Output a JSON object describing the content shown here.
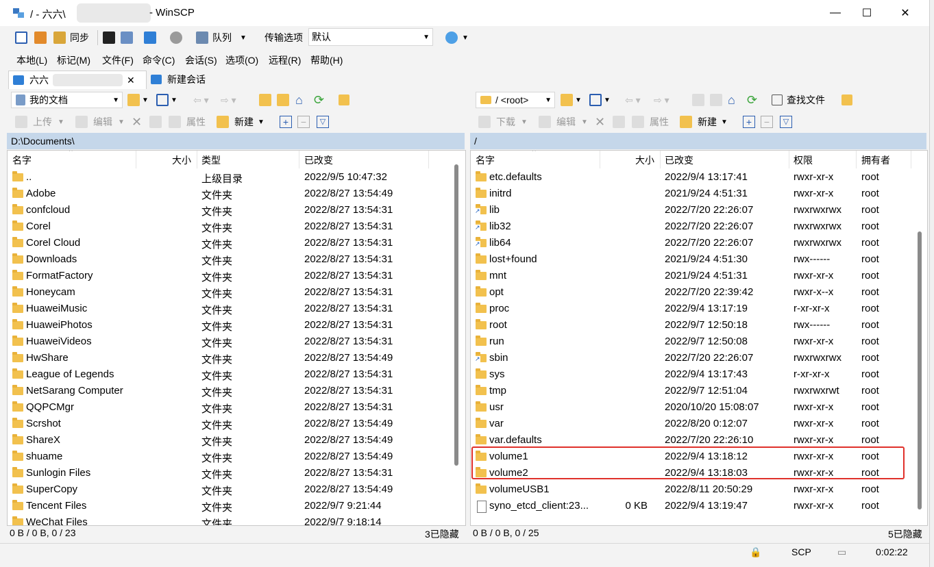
{
  "window": {
    "title_prefix": "/ - 六六\\",
    "title_suffix": "- WinSCP",
    "minimize": "—",
    "maximize": "☐",
    "close": "✕"
  },
  "toolbar": {
    "sync_label": "同步",
    "queue_label": "队列",
    "transfer_options_label": "传输选项",
    "transfer_options_value": "默认"
  },
  "menu": [
    "本地(L)",
    "标记(M)",
    "文件(F)",
    "命令(C)",
    "会话(S)",
    "选项(O)",
    "远程(R)",
    "帮助(H)"
  ],
  "tabs": {
    "session_tab": "六六",
    "close_glyph": "✕",
    "new_session": "新建会话"
  },
  "left": {
    "location": "我的文档",
    "upload": "上传",
    "edit": "编辑",
    "properties": "属性",
    "new": "新建",
    "path": "D:\\Documents\\",
    "headers": {
      "name": "名字",
      "size": "大小",
      "type": "类型",
      "changed": "已改变"
    },
    "rows": [
      {
        "name": "..",
        "type": "上级目录",
        "changed": "2022/9/5  10:47:32",
        "icon": "parent-folder-icon"
      },
      {
        "name": "Adobe",
        "type": "文件夹",
        "changed": "2022/8/27  13:54:49",
        "icon": "folder-icon"
      },
      {
        "name": "confcloud",
        "type": "文件夹",
        "changed": "2022/8/27  13:54:31",
        "icon": "folder-icon"
      },
      {
        "name": "Corel",
        "type": "文件夹",
        "changed": "2022/8/27  13:54:31",
        "icon": "folder-icon"
      },
      {
        "name": "Corel Cloud",
        "type": "文件夹",
        "changed": "2022/8/27  13:54:31",
        "icon": "folder-icon"
      },
      {
        "name": "Downloads",
        "type": "文件夹",
        "changed": "2022/8/27  13:54:31",
        "icon": "folder-icon"
      },
      {
        "name": "FormatFactory",
        "type": "文件夹",
        "changed": "2022/8/27  13:54:31",
        "icon": "folder-icon"
      },
      {
        "name": "Honeycam",
        "type": "文件夹",
        "changed": "2022/8/27  13:54:31",
        "icon": "folder-icon"
      },
      {
        "name": "HuaweiMusic",
        "type": "文件夹",
        "changed": "2022/8/27  13:54:31",
        "icon": "folder-icon"
      },
      {
        "name": "HuaweiPhotos",
        "type": "文件夹",
        "changed": "2022/8/27  13:54:31",
        "icon": "folder-icon"
      },
      {
        "name": "HuaweiVideos",
        "type": "文件夹",
        "changed": "2022/8/27  13:54:31",
        "icon": "folder-icon"
      },
      {
        "name": "HwShare",
        "type": "文件夹",
        "changed": "2022/8/27  13:54:49",
        "icon": "folder-icon"
      },
      {
        "name": "League of Legends",
        "type": "文件夹",
        "changed": "2022/8/27  13:54:31",
        "icon": "folder-icon"
      },
      {
        "name": "NetSarang Computer",
        "type": "文件夹",
        "changed": "2022/8/27  13:54:31",
        "icon": "folder-icon"
      },
      {
        "name": "QQPCMgr",
        "type": "文件夹",
        "changed": "2022/8/27  13:54:31",
        "icon": "folder-icon"
      },
      {
        "name": "Scrshot",
        "type": "文件夹",
        "changed": "2022/8/27  13:54:49",
        "icon": "folder-icon"
      },
      {
        "name": "ShareX",
        "type": "文件夹",
        "changed": "2022/8/27  13:54:49",
        "icon": "folder-icon"
      },
      {
        "name": "shuame",
        "type": "文件夹",
        "changed": "2022/8/27  13:54:49",
        "icon": "folder-icon"
      },
      {
        "name": "Sunlogin Files",
        "type": "文件夹",
        "changed": "2022/8/27  13:54:31",
        "icon": "folder-icon"
      },
      {
        "name": "SuperCopy",
        "type": "文件夹",
        "changed": "2022/8/27  13:54:49",
        "icon": "folder-icon"
      },
      {
        "name": "Tencent Files",
        "type": "文件夹",
        "changed": "2022/9/7  9:21:44",
        "icon": "folder-icon"
      },
      {
        "name": "WeChat Files",
        "type": "文件夹",
        "changed": "2022/9/7  9:18:14",
        "icon": "folder-icon"
      }
    ],
    "status_left": "0 B / 0 B,  0 / 23",
    "status_right": "3已隐藏"
  },
  "right": {
    "location": "/ <root>",
    "download": "下载",
    "edit": "编辑",
    "properties": "属性",
    "new": "新建",
    "find_files": "查找文件",
    "path": "/",
    "headers": {
      "name": "名字",
      "size": "大小",
      "changed": "已改变",
      "rights": "权限",
      "owner": "拥有者"
    },
    "rows": [
      {
        "name": "etc.defaults",
        "size": "",
        "changed": "2022/9/4 13:17:41",
        "rights": "rwxr-xr-x",
        "owner": "root",
        "icon": "folder-icon",
        "link": false
      },
      {
        "name": "initrd",
        "size": "",
        "changed": "2021/9/24 4:51:31",
        "rights": "rwxr-xr-x",
        "owner": "root",
        "icon": "folder-icon",
        "link": false
      },
      {
        "name": "lib",
        "size": "",
        "changed": "2022/7/20 22:26:07",
        "rights": "rwxrwxrwx",
        "owner": "root",
        "icon": "folder-link-icon",
        "link": true
      },
      {
        "name": "lib32",
        "size": "",
        "changed": "2022/7/20 22:26:07",
        "rights": "rwxrwxrwx",
        "owner": "root",
        "icon": "folder-link-icon",
        "link": true
      },
      {
        "name": "lib64",
        "size": "",
        "changed": "2022/7/20 22:26:07",
        "rights": "rwxrwxrwx",
        "owner": "root",
        "icon": "folder-link-icon",
        "link": true
      },
      {
        "name": "lost+found",
        "size": "",
        "changed": "2021/9/24 4:51:30",
        "rights": "rwx------",
        "owner": "root",
        "icon": "folder-icon",
        "link": false
      },
      {
        "name": "mnt",
        "size": "",
        "changed": "2021/9/24 4:51:31",
        "rights": "rwxr-xr-x",
        "owner": "root",
        "icon": "folder-icon",
        "link": false
      },
      {
        "name": "opt",
        "size": "",
        "changed": "2022/7/20 22:39:42",
        "rights": "rwxr-x--x",
        "owner": "root",
        "icon": "folder-icon",
        "link": false
      },
      {
        "name": "proc",
        "size": "",
        "changed": "2022/9/4 13:17:19",
        "rights": "r-xr-xr-x",
        "owner": "root",
        "icon": "folder-icon",
        "link": false
      },
      {
        "name": "root",
        "size": "",
        "changed": "2022/9/7 12:50:18",
        "rights": "rwx------",
        "owner": "root",
        "icon": "folder-icon",
        "link": false
      },
      {
        "name": "run",
        "size": "",
        "changed": "2022/9/7 12:50:08",
        "rights": "rwxr-xr-x",
        "owner": "root",
        "icon": "folder-icon",
        "link": false
      },
      {
        "name": "sbin",
        "size": "",
        "changed": "2022/7/20 22:26:07",
        "rights": "rwxrwxrwx",
        "owner": "root",
        "icon": "folder-link-icon",
        "link": true
      },
      {
        "name": "sys",
        "size": "",
        "changed": "2022/9/4 13:17:43",
        "rights": "r-xr-xr-x",
        "owner": "root",
        "icon": "folder-icon",
        "link": false
      },
      {
        "name": "tmp",
        "size": "",
        "changed": "2022/9/7 12:51:04",
        "rights": "rwxrwxrwt",
        "owner": "root",
        "icon": "folder-icon",
        "link": false
      },
      {
        "name": "usr",
        "size": "",
        "changed": "2020/10/20 15:08:07",
        "rights": "rwxr-xr-x",
        "owner": "root",
        "icon": "folder-icon",
        "link": false
      },
      {
        "name": "var",
        "size": "",
        "changed": "2022/8/20 0:12:07",
        "rights": "rwxr-xr-x",
        "owner": "root",
        "icon": "folder-icon",
        "link": false
      },
      {
        "name": "var.defaults",
        "size": "",
        "changed": "2022/7/20 22:26:10",
        "rights": "rwxr-xr-x",
        "owner": "root",
        "icon": "folder-icon",
        "link": false
      },
      {
        "name": "volume1",
        "size": "",
        "changed": "2022/9/4 13:18:12",
        "rights": "rwxr-xr-x",
        "owner": "root",
        "icon": "folder-icon",
        "link": false
      },
      {
        "name": "volume2",
        "size": "",
        "changed": "2022/9/4 13:18:03",
        "rights": "rwxr-xr-x",
        "owner": "root",
        "icon": "folder-icon",
        "link": false
      },
      {
        "name": "volumeUSB1",
        "size": "",
        "changed": "2022/8/11 20:50:29",
        "rights": "rwxr-xr-x",
        "owner": "root",
        "icon": "folder-icon",
        "link": false
      },
      {
        "name": "syno_etcd_client:23...",
        "size": "0 KB",
        "changed": "2022/9/4 13:19:47",
        "rights": "rwxr-xr-x",
        "owner": "root",
        "icon": "file-icon",
        "link": false
      }
    ],
    "status_left": "0 B / 0 B,  0 / 25",
    "status_right": "5已隐藏"
  },
  "statusbar": {
    "protocol": "SCP",
    "elapsed": "0:02:22"
  },
  "colors": {
    "path_bar": "#c5d7ea",
    "highlight_box": "#e0302a",
    "folder": "#f2c14e"
  }
}
